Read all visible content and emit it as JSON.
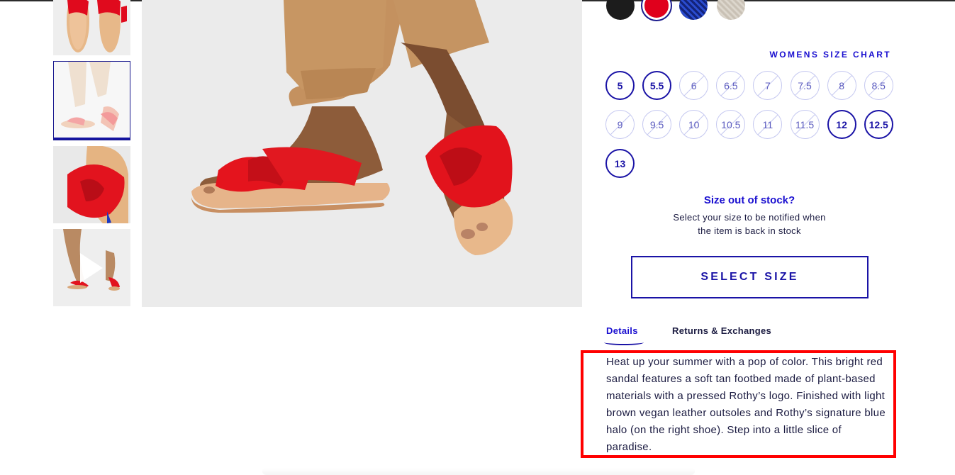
{
  "gallery": {
    "thumbnails": [
      {
        "name": "thumbnail-sole-view"
      },
      {
        "name": "thumbnail-worn-view",
        "selected": true
      },
      {
        "name": "thumbnail-top-view"
      },
      {
        "name": "thumbnail-video"
      }
    ]
  },
  "colors": {
    "accent": "#1a13a6",
    "highlight": "#ff0000",
    "swatches": [
      "#1c1c1c",
      "#e0001c",
      "#13237a",
      "#c9c1b5"
    ]
  },
  "size_chart_label": "WOMENS SIZE CHART",
  "sizes": [
    {
      "label": "5",
      "available": true
    },
    {
      "label": "5.5",
      "available": true
    },
    {
      "label": "6",
      "available": false
    },
    {
      "label": "6.5",
      "available": false
    },
    {
      "label": "7",
      "available": false
    },
    {
      "label": "7.5",
      "available": false
    },
    {
      "label": "8",
      "available": false
    },
    {
      "label": "8.5",
      "available": false
    },
    {
      "label": "9",
      "available": false
    },
    {
      "label": "9.5",
      "available": false
    },
    {
      "label": "10",
      "available": false
    },
    {
      "label": "10.5",
      "available": false
    },
    {
      "label": "11",
      "available": false
    },
    {
      "label": "11.5",
      "available": false
    },
    {
      "label": "12",
      "available": true
    },
    {
      "label": "12.5",
      "available": true
    },
    {
      "label": "13",
      "available": true
    }
  ],
  "out_of_stock": {
    "title": "Size out of stock?",
    "line1": "Select your size to be notified when",
    "line2": "the item is back in stock"
  },
  "select_size_button": "SELECT SIZE",
  "tabs": {
    "details": "Details",
    "returns": "Returns & Exchanges"
  },
  "description": "Heat up your summer with a pop of color. This bright red sandal features a soft tan footbed made of plant-based materials with a pressed Rothy’s logo. Finished with light brown vegan leather outsoles and Rothy’s signature blue halo (on the right shoe). Step into a little slice of paradise."
}
